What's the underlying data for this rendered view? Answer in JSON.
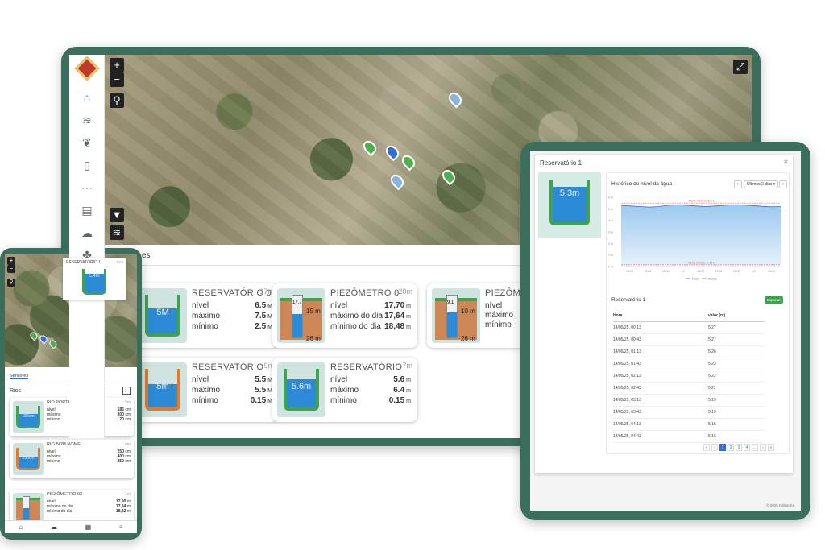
{
  "desktop": {
    "map": {
      "zoom_in": "+",
      "zoom_out": "−",
      "fullscreen_icon": "fullscreen-icon"
    },
    "sidebar": {
      "icons": [
        "home-icon",
        "layers-icon",
        "sprout-icon",
        "clipboard-icon",
        "grid-icon",
        "document-icon",
        "weather-icon",
        "puzzle-icon"
      ]
    },
    "tab_label": "es",
    "cards": [
      {
        "title": "RESERVATÓRIO 01",
        "age": "17m",
        "kind": "reservoir",
        "level_label": "5M",
        "fill": 0.65,
        "rows": [
          {
            "label": "nível",
            "value": "6.5",
            "unit": "M"
          },
          {
            "label": "máximo",
            "value": "7.5",
            "unit": "M"
          },
          {
            "label": "mínimo",
            "value": "2.5",
            "unit": "M"
          }
        ]
      },
      {
        "title": "PIEZÔMETRO 0",
        "age": "20m",
        "kind": "piezo",
        "pipe_top": "17,7",
        "pipe_level": "15 m",
        "depth": "26 m",
        "fill": 0.55,
        "rows": [
          {
            "label": "nível",
            "value": "17,70",
            "unit": "m"
          },
          {
            "label": "máximo do dia",
            "value": "17,64",
            "unit": "m"
          },
          {
            "label": "mínimo do dia",
            "value": "18,48",
            "unit": "m"
          }
        ]
      },
      {
        "title": "PIEZÔME",
        "age": "",
        "kind": "piezo",
        "pipe_top": "9,1",
        "pipe_level": "10 m",
        "depth": "26 m",
        "fill": 0.6,
        "rows": [
          {
            "label": "nível",
            "value": "",
            "unit": ""
          },
          {
            "label": "máximo",
            "value": "",
            "unit": ""
          },
          {
            "label": "mínimo",
            "value": "",
            "unit": ""
          }
        ]
      },
      {
        "title": "RESERVATÓRIO",
        "age": "9m",
        "kind": "reservoir",
        "level_label": "5m",
        "fill": 0.6,
        "rows": [
          {
            "label": "nível",
            "value": "5.5",
            "unit": "M"
          },
          {
            "label": "máximo",
            "value": "5.5",
            "unit": "M"
          },
          {
            "label": "mínimo",
            "value": "0.15",
            "unit": "M"
          }
        ]
      },
      {
        "title": "RESERVATÓRIO",
        "age": "7m",
        "kind": "reservoir",
        "level_label": "5.6m",
        "fill": 0.72,
        "rows": [
          {
            "label": "nível",
            "value": "5.6",
            "unit": "m"
          },
          {
            "label": "máximo",
            "value": "6.4",
            "unit": "m"
          },
          {
            "label": "mínimo",
            "value": "0.15",
            "unit": "m"
          }
        ]
      }
    ]
  },
  "tablet": {
    "modal_title": "Reservatório 1",
    "close": "×",
    "vessel_label": "5.3m",
    "chart_title": "Histórico do nível da água",
    "range_button": "Últimos 2 dias ▾",
    "prev": "‹",
    "next": "›",
    "export_button": "Exportar",
    "table_title": "Reservatório 1",
    "table_headers": [
      "Hora",
      "valor (m)"
    ],
    "rows": [
      [
        "14/05/25, 00:13",
        "5,27"
      ],
      [
        "14/05/25, 00:43",
        "5,27"
      ],
      [
        "14/05/25, 01:13",
        "5,26"
      ],
      [
        "14/05/25, 01:43",
        "5,23"
      ],
      [
        "14/05/25, 02:13",
        "5,22"
      ],
      [
        "14/05/25, 02:43",
        "5,21"
      ],
      [
        "14/05/25, 03:13",
        "5,19"
      ],
      [
        "14/05/25, 03:43",
        "5,19"
      ],
      [
        "14/05/25, 04:13",
        "5,15"
      ],
      [
        "14/05/25, 04:43",
        "5,16"
      ]
    ],
    "pager": [
      "«",
      "‹",
      "1",
      "2",
      "3",
      "4",
      "…",
      "›",
      "»"
    ],
    "footer": "© 2025 Kallandra",
    "chart_data": {
      "type": "area",
      "title": "Histórico do nível da água",
      "x": [
        "06:00",
        "12:00",
        "18:00",
        "14",
        "06:00",
        "12:00",
        "18:00",
        "15",
        "06:00"
      ],
      "y_ticks": [
        "6 m",
        "5 m",
        "4 m",
        "3 m",
        "2 m",
        "1 m",
        "0 m"
      ],
      "ylim": [
        0,
        6
      ],
      "series": [
        {
          "name": "Nível",
          "values": [
            5.3,
            5.25,
            5.2,
            5.15,
            5.2,
            5.3,
            5.35,
            5.3,
            5.25,
            5.2,
            5.25,
            5.3,
            5.35,
            5.32,
            5.28,
            5.22,
            5.18,
            5.2
          ]
        },
        {
          "name": "Alertas",
          "values": []
        }
      ],
      "annotations": [
        "Alerta máximo: 5.5 m",
        "Alerta mínimo: 0.15 m"
      ],
      "legend": "bottom"
    }
  },
  "phone": {
    "popup_title": "RESERVATÓRIO 1",
    "popup_age": "21m",
    "popup_label": "5.4m",
    "tab": "Sensores",
    "section": "Rios",
    "nav_icons": [
      "home-icon",
      "weather-icon",
      "calculator-icon",
      "menu-icon"
    ],
    "cards": [
      {
        "title": "RIO PORTARIA",
        "age": "5m",
        "label": "186cm",
        "rows": [
          {
            "label": "nível",
            "value": "186",
            "unit": "cm"
          },
          {
            "label": "máximo",
            "value": "300",
            "unit": "cm"
          },
          {
            "label": "mínimo",
            "value": "20",
            "unit": "cm"
          }
        ]
      },
      {
        "title": "RIO BOM NOME",
        "age": "4m",
        "label": "250cm",
        "rows": [
          {
            "label": "nível",
            "value": "250",
            "unit": "cm"
          },
          {
            "label": "máximo",
            "value": "400",
            "unit": "cm"
          },
          {
            "label": "mínimo",
            "value": "250",
            "unit": "cm"
          }
        ]
      },
      {
        "title": "PIEZÔMETRO 03",
        "age": "1m",
        "label": "",
        "rows": [
          {
            "label": "nível",
            "value": "17,90",
            "unit": "m"
          },
          {
            "label": "máximo do dia",
            "value": "17,84",
            "unit": "m"
          },
          {
            "label": "mínimo do dia",
            "value": "18,42",
            "unit": "m"
          }
        ]
      }
    ]
  }
}
